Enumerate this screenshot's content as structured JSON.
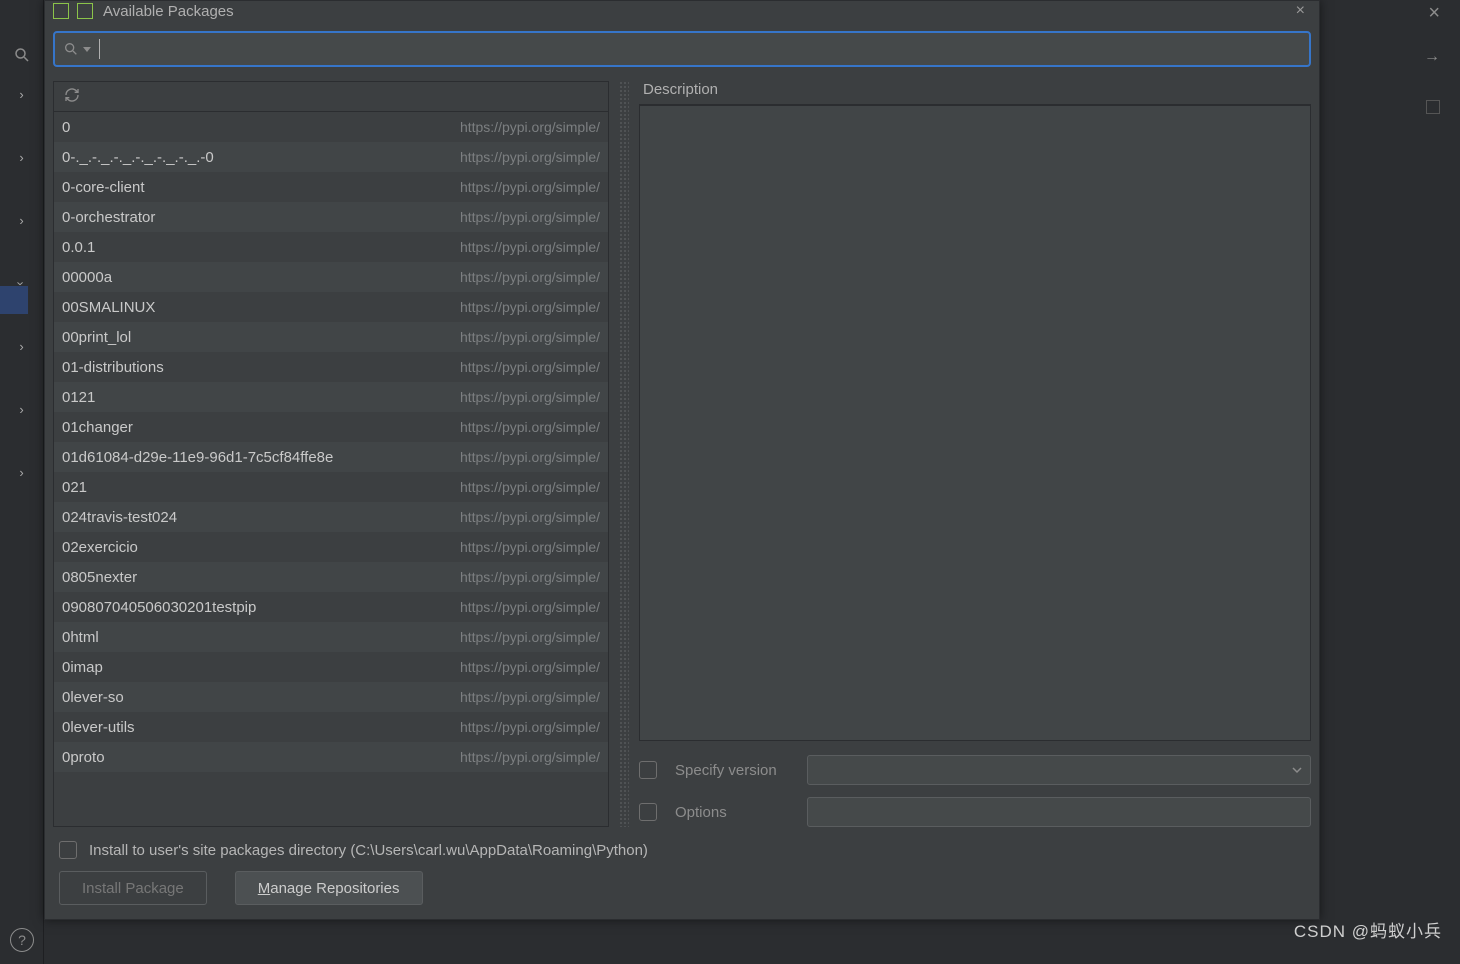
{
  "dialog": {
    "title": "Available Packages",
    "search_placeholder": "",
    "description_label": "Description",
    "specify_version_label": "Specify version",
    "options_label": "Options",
    "install_user_label": "Install to user's site packages directory (C:\\Users\\carl.wu\\AppData\\Roaming\\Python)",
    "install_button": "Install Package",
    "manage_button_prefix": "M",
    "manage_button_rest": "anage Repositories"
  },
  "repo_url": "https://pypi.org/simple/",
  "packages": [
    {
      "name": "0"
    },
    {
      "name": "0-._.-._.-._.-._.-._.-._.-0"
    },
    {
      "name": "0-core-client"
    },
    {
      "name": "0-orchestrator"
    },
    {
      "name": "0.0.1"
    },
    {
      "name": "00000a"
    },
    {
      "name": "00SMALINUX"
    },
    {
      "name": "00print_lol"
    },
    {
      "name": "01-distributions"
    },
    {
      "name": "0121"
    },
    {
      "name": "01changer"
    },
    {
      "name": "01d61084-d29e-11e9-96d1-7c5cf84ffe8e"
    },
    {
      "name": "021"
    },
    {
      "name": "024travis-test024"
    },
    {
      "name": "02exercicio"
    },
    {
      "name": "0805nexter"
    },
    {
      "name": "090807040506030201testpip"
    },
    {
      "name": "0html"
    },
    {
      "name": "0imap"
    },
    {
      "name": "0lever-so"
    },
    {
      "name": "0lever-utils"
    },
    {
      "name": "0proto"
    }
  ],
  "watermark": "CSDN @蚂蚁小兵"
}
